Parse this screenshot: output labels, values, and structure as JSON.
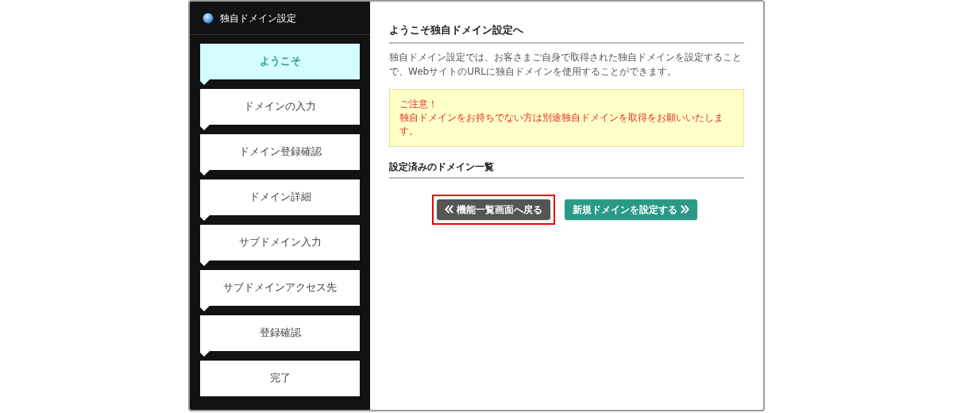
{
  "sidebar": {
    "title": "独自ドメイン設定",
    "steps": [
      {
        "label": "ようこそ",
        "selected": true
      },
      {
        "label": "ドメインの入力",
        "selected": false
      },
      {
        "label": "ドメイン登録確認",
        "selected": false
      },
      {
        "label": "ドメイン詳細",
        "selected": false
      },
      {
        "label": "サブドメイン入力",
        "selected": false
      },
      {
        "label": "サブドメインアクセス先",
        "selected": false
      },
      {
        "label": "登録確認",
        "selected": false
      },
      {
        "label": "完了",
        "selected": false
      }
    ]
  },
  "main": {
    "heading": "ようこそ独自ドメイン設定へ",
    "intro": "独自ドメイン設定では、お客さまご自身で取得された独自ドメインを設定することで、WebサイトのURLに独自ドメインを使用することができます。",
    "notice": {
      "title": "ご注意！",
      "text": "独自ドメインをお持ちでない方は別途独自ドメインを取得をお願いいたします。"
    },
    "list_heading": "設定済みのドメイン一覧",
    "buttons": [
      {
        "kind": "back",
        "label": "機能一覧画面へ戻る",
        "highlighted": true
      },
      {
        "kind": "next",
        "label": "新規ドメインを設定する",
        "highlighted": false
      }
    ]
  }
}
